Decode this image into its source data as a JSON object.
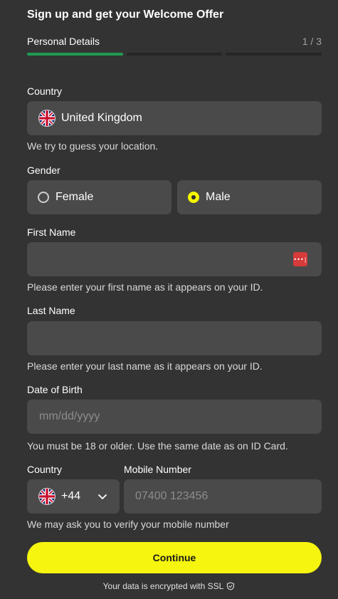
{
  "header": {
    "title": "Sign up and get your Welcome Offer",
    "step_label": "Personal Details",
    "step_count": "1 / 3",
    "progress_steps": 3,
    "progress_current": 1
  },
  "country_field": {
    "label": "Country",
    "value": "United Kingdom",
    "hint": "We try to guess your location.",
    "flag_icon": "uk-flag-icon"
  },
  "gender": {
    "label": "Gender",
    "options": [
      {
        "label": "Female",
        "selected": false
      },
      {
        "label": "Male",
        "selected": true
      }
    ]
  },
  "first_name": {
    "label": "First Name",
    "value": "",
    "hint": "Please enter your first name as it appears on your ID."
  },
  "last_name": {
    "label": "Last Name",
    "value": "",
    "hint": "Please enter your last name as it appears on your ID."
  },
  "dob": {
    "label": "Date of Birth",
    "placeholder": "mm/dd/yyyy",
    "hint": "You must be 18 or older. Use the same date as on ID Card."
  },
  "phone": {
    "country_label": "Country",
    "dial_code": "+44",
    "number_label": "Mobile Number",
    "placeholder": "07400 123456",
    "hint": "We may ask you to verify your mobile number"
  },
  "actions": {
    "continue_label": "Continue",
    "ssl_text": "Your data is encrypted with SSL"
  },
  "colors": {
    "background": "#333333",
    "field": "#4a4a4a",
    "accent_yellow": "#f5f510",
    "progress_active": "#1f9a52"
  }
}
